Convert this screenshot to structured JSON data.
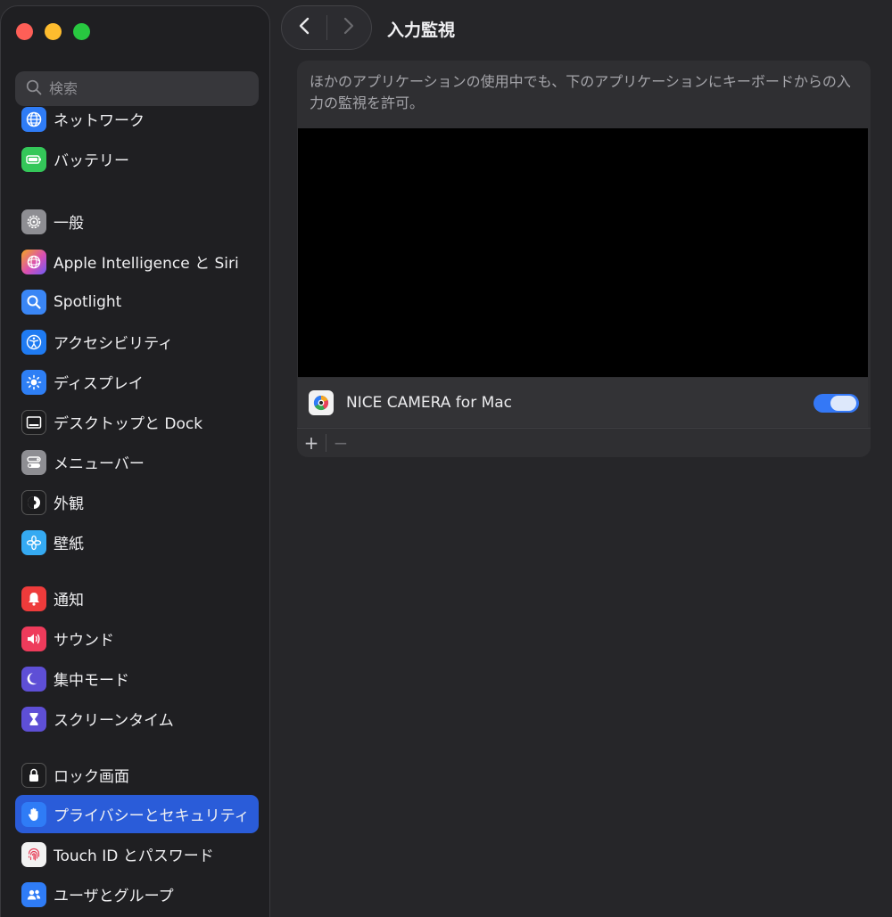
{
  "window": {
    "traffic_lights": [
      "close",
      "minimize",
      "zoom"
    ]
  },
  "search": {
    "placeholder": "検索",
    "value": ""
  },
  "sidebar": {
    "items": [
      {
        "label": "ネットワーク",
        "icon": "globe-icon",
        "color": "#2f7cf6"
      },
      {
        "label": "バッテリー",
        "icon": "battery-icon",
        "color": "#34c759"
      },
      {
        "label": "一般",
        "icon": "gear-icon",
        "color": "#8e8e93"
      },
      {
        "label": "Apple Intelligence と Siri",
        "icon": "siri-icon",
        "color": "#d94fb3"
      },
      {
        "label": "Spotlight",
        "icon": "magnifier-icon",
        "color": "#3a86f5"
      },
      {
        "label": "アクセシビリティ",
        "icon": "accessibility-icon",
        "color": "#1f7bf2"
      },
      {
        "label": "ディスプレイ",
        "icon": "sun-icon",
        "color": "#2e7ff5"
      },
      {
        "label": "デスクトップと Dock",
        "icon": "dock-icon",
        "color": "#1c1c1e"
      },
      {
        "label": "メニューバー",
        "icon": "menubar-icon",
        "color": "#8e8e93"
      },
      {
        "label": "外観",
        "icon": "appearance-icon",
        "color": "#1c1c1e"
      },
      {
        "label": "壁紙",
        "icon": "flower-icon",
        "color": "#35aaf2"
      },
      {
        "label": "通知",
        "icon": "bell-icon",
        "color": "#ee3b3b"
      },
      {
        "label": "サウンド",
        "icon": "speaker-icon",
        "color": "#ee3b5b"
      },
      {
        "label": "集中モード",
        "icon": "moon-icon",
        "color": "#5e4fd6"
      },
      {
        "label": "スクリーンタイム",
        "icon": "hourglass-icon",
        "color": "#5e4fd6"
      },
      {
        "label": "ロック画面",
        "icon": "lock-icon",
        "color": "#1c1c1e"
      },
      {
        "label": "プライバシーとセキュリティ",
        "icon": "hand-icon",
        "color": "#2f7cf6",
        "active": true
      },
      {
        "label": "Touch ID とパスワード",
        "icon": "fingerprint-icon",
        "color": "#f2f2f2"
      },
      {
        "label": "ユーザとグループ",
        "icon": "users-icon",
        "color": "#2f7cf6"
      }
    ]
  },
  "toolbar": {
    "back_icon": "chevron-left-icon",
    "forward_icon": "chevron-right-icon",
    "title": "入力監視"
  },
  "panel": {
    "description": "ほかのアプリケーションの使用中でも、下のアプリケーションにキーボードからの入力の監視を許可。",
    "apps": [
      {
        "name": "NICE CAMERA for Mac",
        "enabled": true
      }
    ],
    "add_label": "+",
    "remove_label": "−"
  },
  "colors": {
    "accent": "#2a5cd9",
    "toggle_on": "#3478f6",
    "background": "#262629",
    "sidebar": "#1f1f22"
  }
}
